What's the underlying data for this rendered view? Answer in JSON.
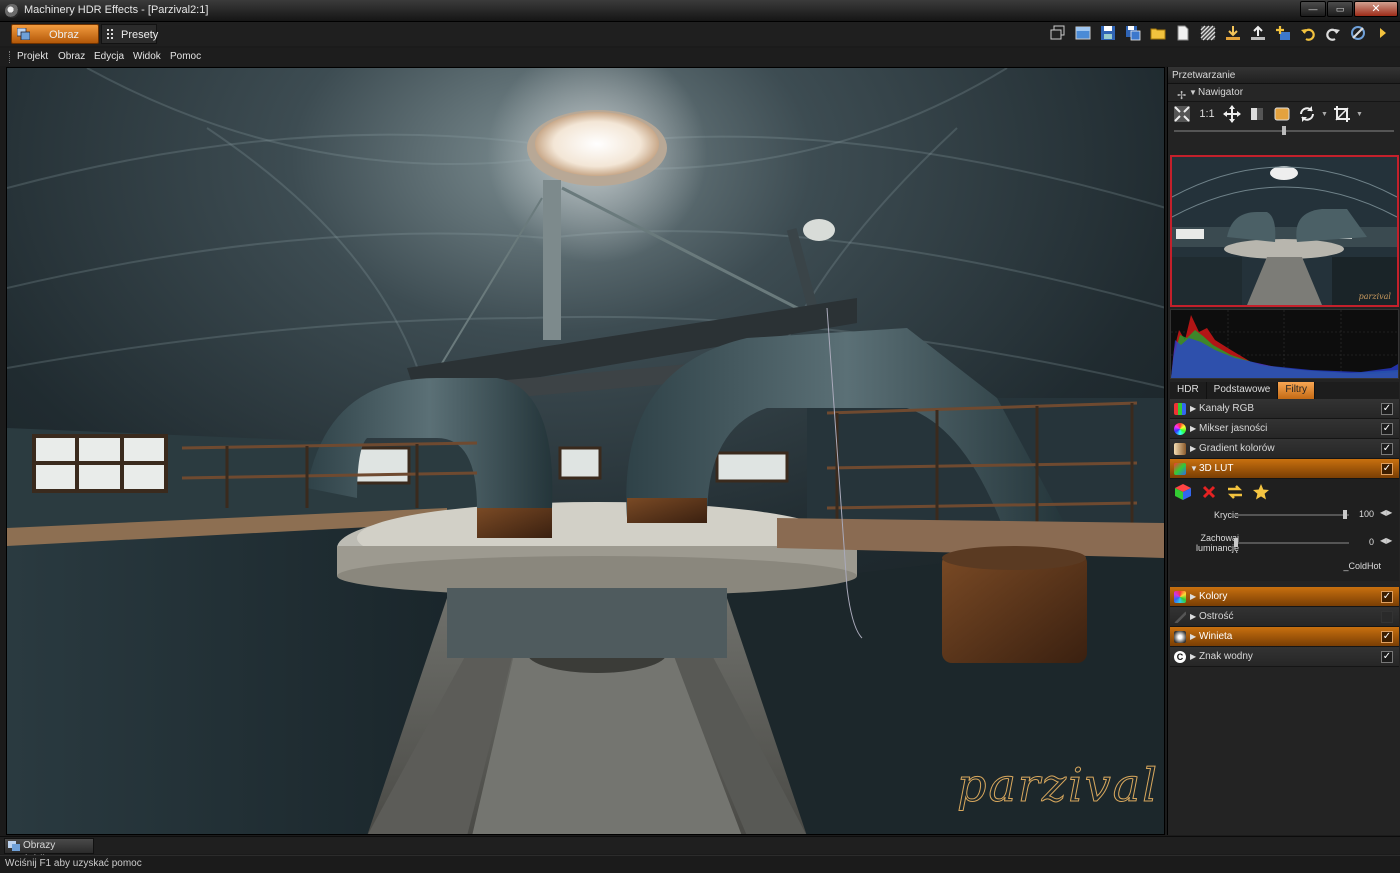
{
  "window": {
    "title": "Machinery HDR Effects - [Parzival2:1]",
    "min_label": "—",
    "max_label": "▭",
    "close_label": "✕"
  },
  "ribbon": {
    "tabs": [
      {
        "label": "Obraz",
        "active": true
      },
      {
        "label": "Presety",
        "active": false
      }
    ],
    "toolbar_icons": [
      "windows-icon",
      "image-icon",
      "save-icon",
      "save-as-icon",
      "open-folder-icon",
      "new-file-icon",
      "pattern-icon",
      "import-icon",
      "export-icon",
      "add-icon",
      "undo-icon",
      "redo-icon",
      "settings-icon",
      "arrow-right-icon"
    ]
  },
  "menu": {
    "items": [
      "Projekt",
      "Obraz",
      "Edycja",
      "Widok",
      "Pomoc"
    ]
  },
  "canvas": {
    "watermark": "parzival"
  },
  "panel": {
    "title": "Przetwarzanie",
    "navigator": {
      "label": "Nawigator",
      "zoom_label": "1:1",
      "zoom_slider_fraction": 0.5,
      "thumbnail_signature": "parzival"
    },
    "tabs": [
      {
        "label": "HDR",
        "active": false
      },
      {
        "label": "Podstawowe",
        "active": false
      },
      {
        "label": "Filtry",
        "active": true
      }
    ],
    "filters": [
      {
        "label": "Kanały RGB",
        "checked": true,
        "highlighted": false,
        "expanded": false
      },
      {
        "label": "Mikser jasności",
        "checked": true,
        "highlighted": false,
        "expanded": false
      },
      {
        "label": "Gradient kolorów",
        "checked": true,
        "highlighted": false,
        "expanded": false
      },
      {
        "label": "3D LUT",
        "checked": true,
        "highlighted": true,
        "expanded": true
      },
      {
        "label": "Kolory",
        "checked": true,
        "highlighted": true,
        "expanded": false
      },
      {
        "label": "Ostrość",
        "checked": false,
        "highlighted": false,
        "expanded": false
      },
      {
        "label": "Winieta",
        "checked": true,
        "highlighted": true,
        "expanded": false
      },
      {
        "label": "Znak wodny",
        "checked": true,
        "highlighted": false,
        "expanded": false
      }
    ],
    "lut": {
      "coverage_label": "Krycie",
      "coverage_value": "100",
      "preserve_label_line1": "Zachowaj",
      "preserve_label_line2": "luminancję",
      "preserve_value": "0",
      "lut_name": "_ColdHot"
    }
  },
  "bottom": {
    "source_tab": "Obrazy źródłowe",
    "status": "Wciśnij F1 aby uzyskać pomoc"
  },
  "colors": {
    "accent": "#e0860e",
    "nav_border": "#c4202b"
  }
}
